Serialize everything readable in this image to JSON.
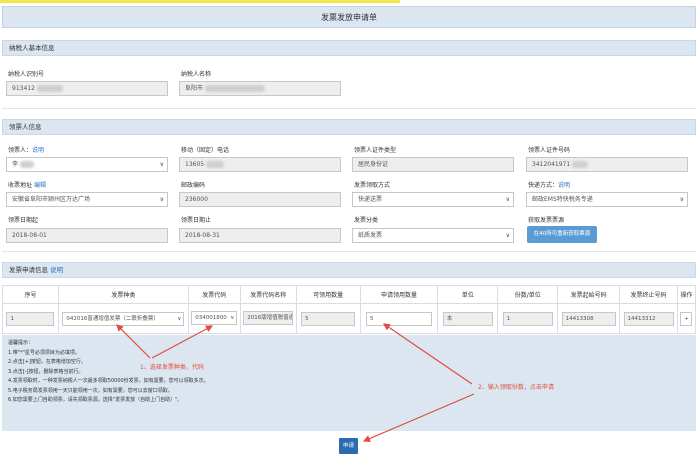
{
  "page_title": "发票发放申请单",
  "taxpayer_section": {
    "heading": "纳税人基本信息",
    "id_label": "纳税人识别号",
    "id_value": "913412",
    "name_label": "纳税人名称",
    "name_value": "阜阳市"
  },
  "recipient_section": {
    "heading": "领票人信息",
    "recipient_label": "领票人",
    "recipient_link": "说明",
    "recipient_value": "李",
    "phone_label": "移动（固定）电话",
    "phone_value": "13605",
    "id_type_label": "领票人证件类型",
    "id_type_value": "居民身份证",
    "id_no_label": "领票人证件号码",
    "id_no_value": "3412041971",
    "address_label": "收票地址",
    "address_link": "编辑",
    "address_value": "安徽省阜阳市颍州区万达广场",
    "postcode_label": "邮政编码",
    "postcode_value": "236000",
    "pickup_label": "发票领取方式",
    "pickup_value": "快递送票",
    "express_label": "快递方式",
    "express_link": "说明",
    "express_value": "邮政EMS特快税务专递",
    "start_date_label": "领票日期起",
    "start_date_value": "2018-08-01",
    "end_date_label": "领票日期止",
    "end_date_value": "2018-08-31",
    "category_label": "发票分类",
    "category_value": "纸质发票",
    "quota_label": "获取发票票源",
    "quota_button": "在40所可重新获取票源"
  },
  "apply_section": {
    "heading": "发票申请信息",
    "heading_link": "说明",
    "columns": [
      "序号",
      "发票种类",
      "发票代码",
      "发票代码名称",
      "可领用数量",
      "申请领用数量",
      "单位",
      "份数/单位",
      "发票起始号码",
      "发票终止号码",
      "操作"
    ],
    "row": {
      "index": "1",
      "type": "042016普通增值发票（二联折叠票）",
      "code": "034001800",
      "code_name": "2016版增值税普通发",
      "available": "5",
      "requested": "5",
      "unit": "本",
      "per_unit": "1",
      "start_no": "14413308",
      "end_no": "14413312",
      "action": "+"
    }
  },
  "notice": {
    "title": "温馨提示：",
    "lines": [
      "1.带\"*\"星号必须项目为必填项。",
      "2.点击[+]按钮，在表格增加空行。",
      "3.点击[-]按钮，删除表格当前行。",
      "4.发票领取时，一种发票纳税人一次最多领取50000份发票，如有需要，您可以领取多次。",
      "5.电子税务局发票领用一天只能领用一次，如有需要，您可以去窗口领取。",
      "6.如您需要上门自助领票，请先领取票源，选择\"发票发放（自助上门自助）\"。"
    ]
  },
  "annotations": {
    "step1": "1、选择发票种类、代码",
    "step2": "2、输入领取份数，点击申请"
  },
  "submit_label": "申请",
  "colors": {
    "section_bg": "#dbe6f1",
    "accent": "#5b9bd5",
    "submit": "#2b6cb0",
    "annotation": "#e24c3c"
  }
}
